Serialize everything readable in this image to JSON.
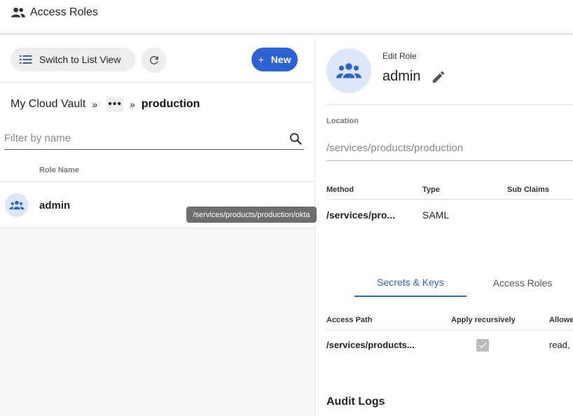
{
  "header": {
    "title": "Access Roles",
    "icon": "people-icon"
  },
  "toolbar": {
    "list_view_label": "Switch to List View",
    "new_label": "New",
    "new_plus": "+"
  },
  "breadcrumb": {
    "root": "My Cloud Vault",
    "separator": "»",
    "more": "•••",
    "current": "production"
  },
  "filter": {
    "placeholder": "Filter by name",
    "value": ""
  },
  "table": {
    "column_role_name": "Role Name",
    "rows": [
      {
        "name": "admin"
      }
    ]
  },
  "tooltip": {
    "text": "/services/products/production/okta"
  },
  "detail": {
    "edit_label": "Edit Role",
    "role_name": "admin",
    "location_label": "Location",
    "location_value": "/services/products/production",
    "methods": {
      "headers": [
        "Method",
        "Type",
        "Sub Claims"
      ],
      "row": {
        "method": "/services/pro...",
        "type": "SAML"
      }
    },
    "tabs": [
      {
        "label": "Secrets & Keys",
        "active": true
      },
      {
        "label": "Access Roles",
        "active": false
      }
    ],
    "secrets": {
      "headers": [
        "Access Path",
        "Apply recursively",
        "Allowe"
      ],
      "row": {
        "path": "/services/products...",
        "recursive": true,
        "allowed": "read,"
      }
    },
    "audit_title": "Audit Logs"
  },
  "colors": {
    "accent": "#2b63d4",
    "avatar_bg": "#dce8f7",
    "tooltip_bg": "#6e6e6e"
  }
}
